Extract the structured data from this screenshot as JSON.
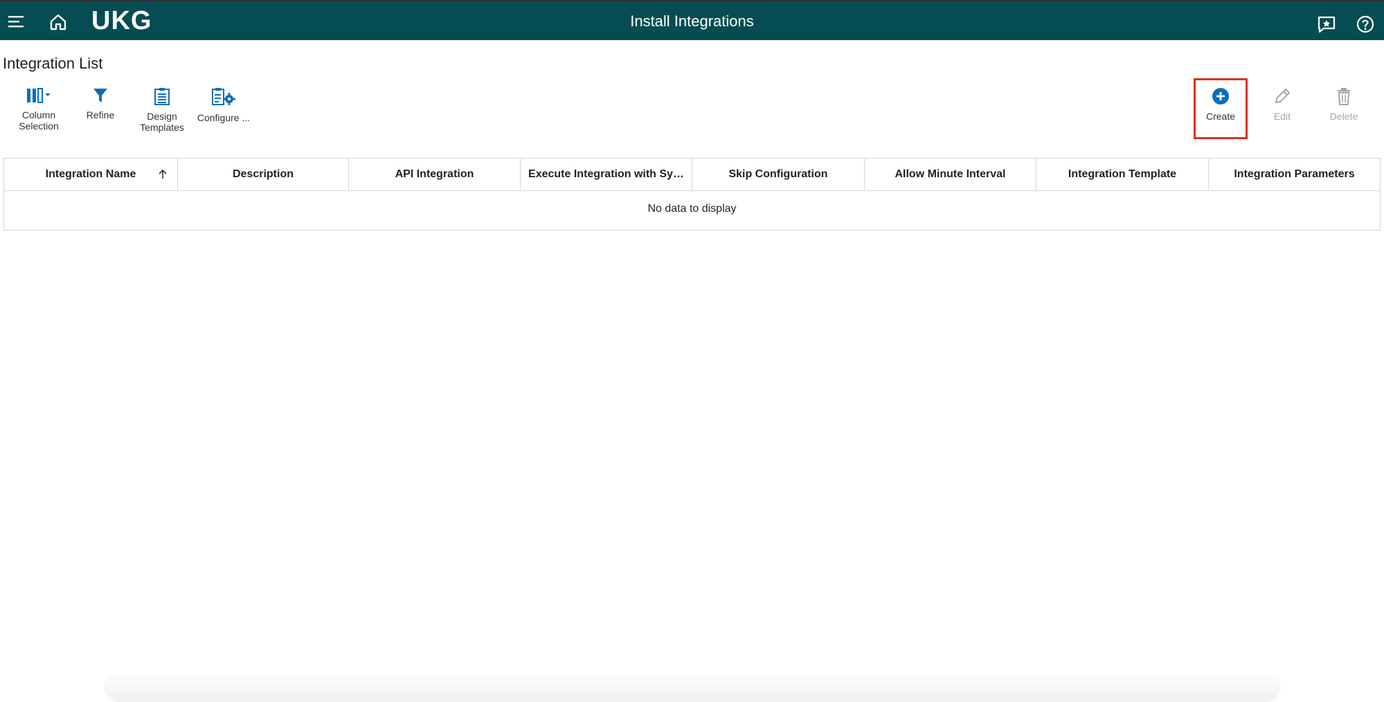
{
  "app": {
    "logo_text": "UKG",
    "title": "Install Integrations"
  },
  "page": {
    "title": "Integration List"
  },
  "toolbar": {
    "left": [
      {
        "label": "Column\nSelection",
        "icon": "column-selection-icon"
      },
      {
        "label": "Refine",
        "icon": "filter-icon"
      },
      {
        "label": "Design\nTemplates",
        "icon": "clipboard-icon"
      },
      {
        "label": "Configure ...",
        "icon": "configure-icon"
      }
    ],
    "right": [
      {
        "label": "Create",
        "icon": "plus-circle-icon",
        "enabled": true
      },
      {
        "label": "Edit",
        "icon": "pencil-icon",
        "enabled": false
      },
      {
        "label": "Delete",
        "icon": "trash-icon",
        "enabled": false
      }
    ]
  },
  "table": {
    "columns": [
      "Integration Name",
      "Description",
      "API Integration",
      "Execute Integration with Sy…",
      "Skip Configuration",
      "Allow Minute Interval",
      "Integration Template",
      "Integration Parameters"
    ],
    "empty_message": "No data to display"
  },
  "colors": {
    "topbar": "#054d52",
    "accent_blue": "#0a6ebd",
    "highlight_red": "#e0301e",
    "disabled": "#a6a6a6"
  }
}
